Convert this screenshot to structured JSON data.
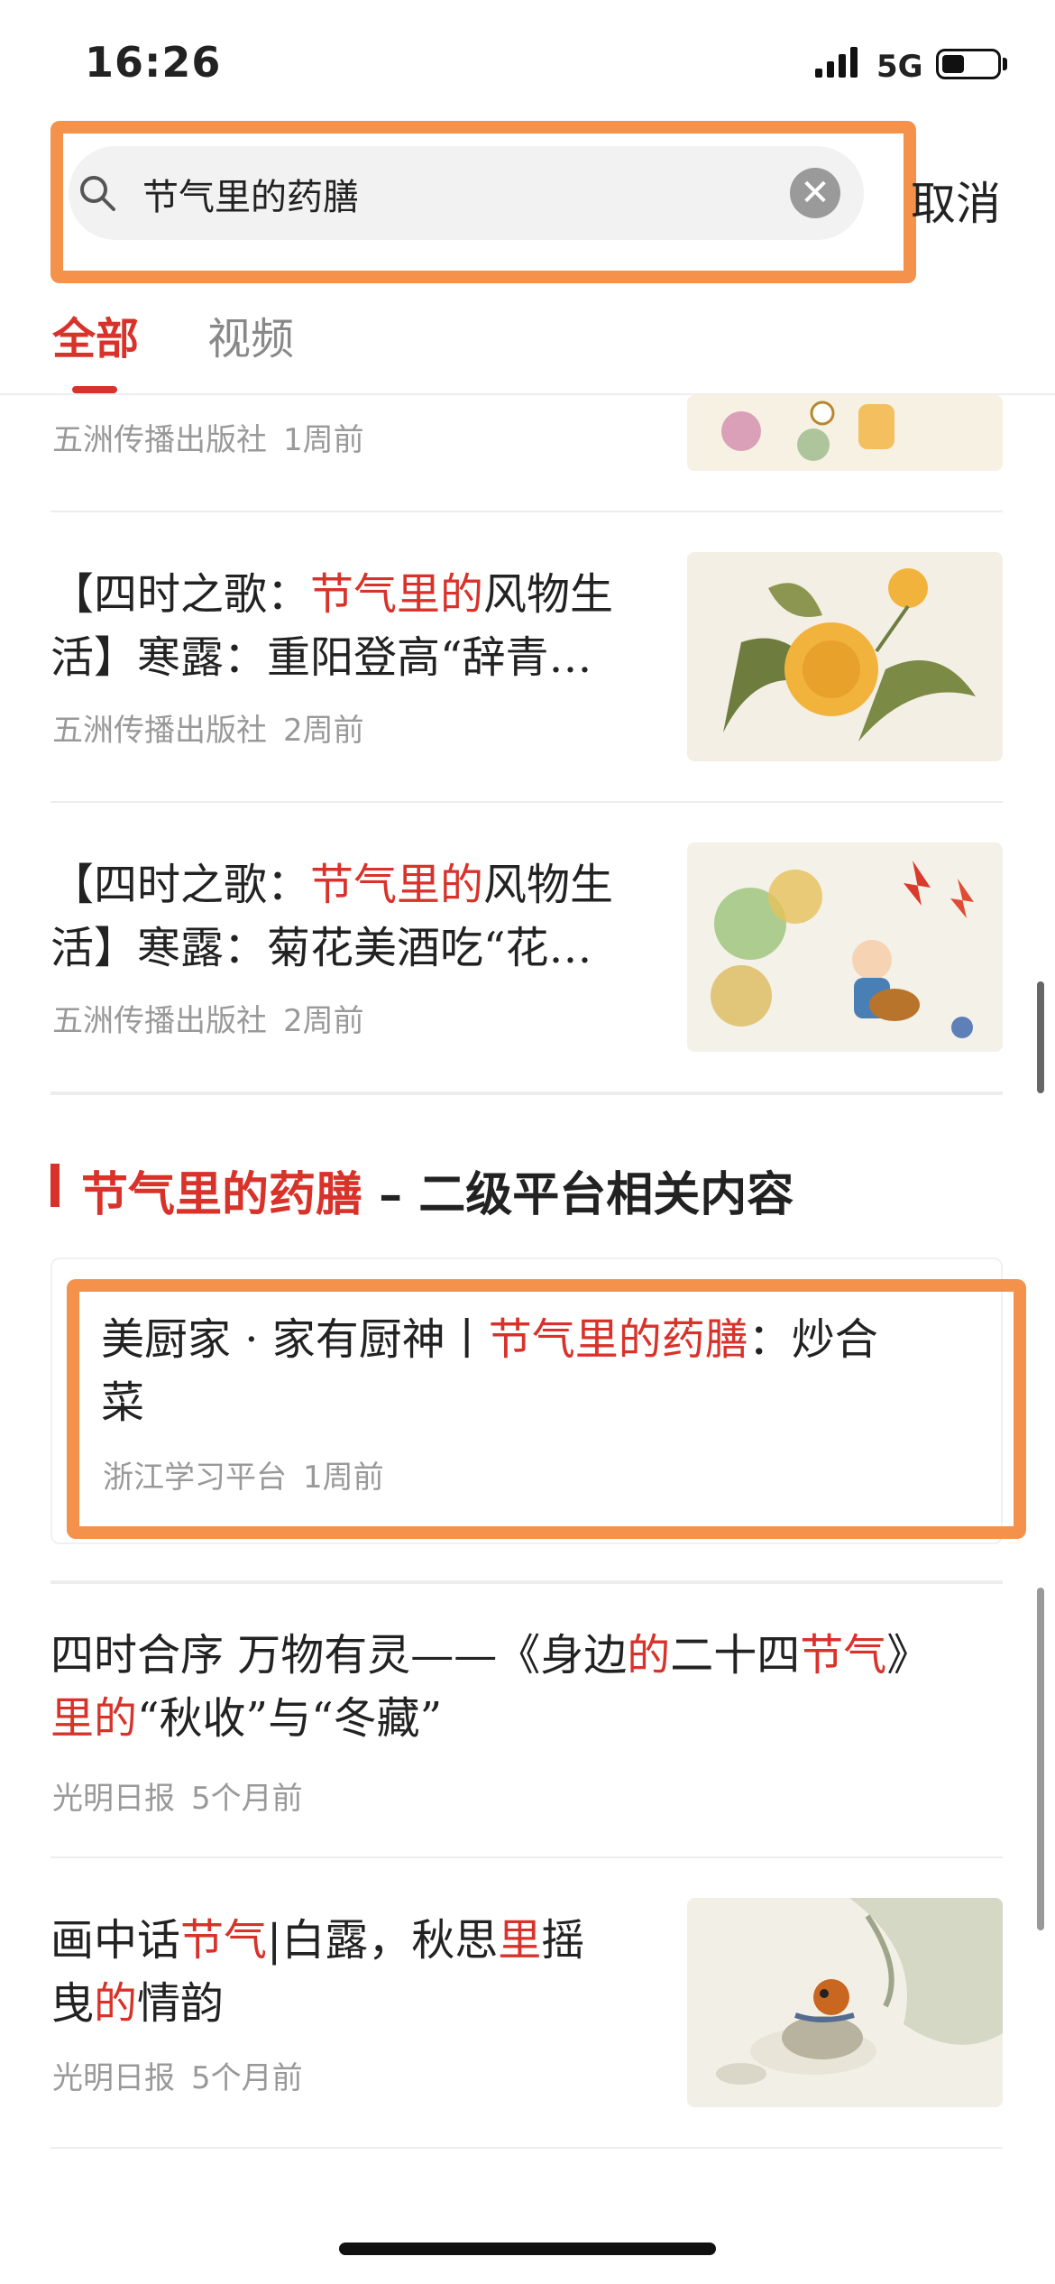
{
  "status_bar": {
    "time": "16:26",
    "network": "5G"
  },
  "search": {
    "query": "节气里的药膳",
    "cancel_label": "取消"
  },
  "tabs": [
    {
      "label": "全部"
    },
    {
      "label": "视频"
    }
  ],
  "results": [
    {
      "source": "五洲传播出版社",
      "time": "1周前"
    },
    {
      "title_line1_pre": "【四时之歌：",
      "title_line1_hl": "节气里的",
      "title_line1_post": "风物生",
      "title_line2": "活】寒露：重阳登高“辞青…",
      "source": "五洲传播出版社",
      "time": "2周前"
    },
    {
      "title_line1_pre": "【四时之歌：",
      "title_line1_hl": "节气里的",
      "title_line1_post": "风物生",
      "title_line2": "活】寒露：菊花美酒吃“花…",
      "source": "五洲传播出版社",
      "time": "2周前"
    }
  ],
  "section": {
    "title_hl": "节气里的药膳",
    "title_rest": "– 二级平台相关内容"
  },
  "card": {
    "title_pre": "美厨家 · 家有厨神丨",
    "title_hl": "节气里的药膳",
    "title_post": "：炒合",
    "title_line2": "菜",
    "source": "浙江学习平台",
    "time": "1周前"
  },
  "results2": [
    {
      "l1_a": "四时合序 万物有灵——《身边",
      "l1_b": "的",
      "l1_c": "二十四",
      "l1_d": "节气",
      "l1_e": "》",
      "l2_a": "里的",
      "l2_b": "“秋收”与“冬藏”",
      "source": "光明日报",
      "time": "5个月前"
    },
    {
      "l1_a": "画中话",
      "l1_b": "节气",
      "l1_c": "|白露，秋思",
      "l1_d": "里",
      "l1_e": "摇",
      "l2_a": "曳",
      "l2_b": "的",
      "l2_c": "情韵",
      "source": "光明日报",
      "time": "5个月前"
    }
  ],
  "colors": {
    "accent": "#D8322A",
    "highlight_box": "#F4914A",
    "meta": "#999999"
  }
}
